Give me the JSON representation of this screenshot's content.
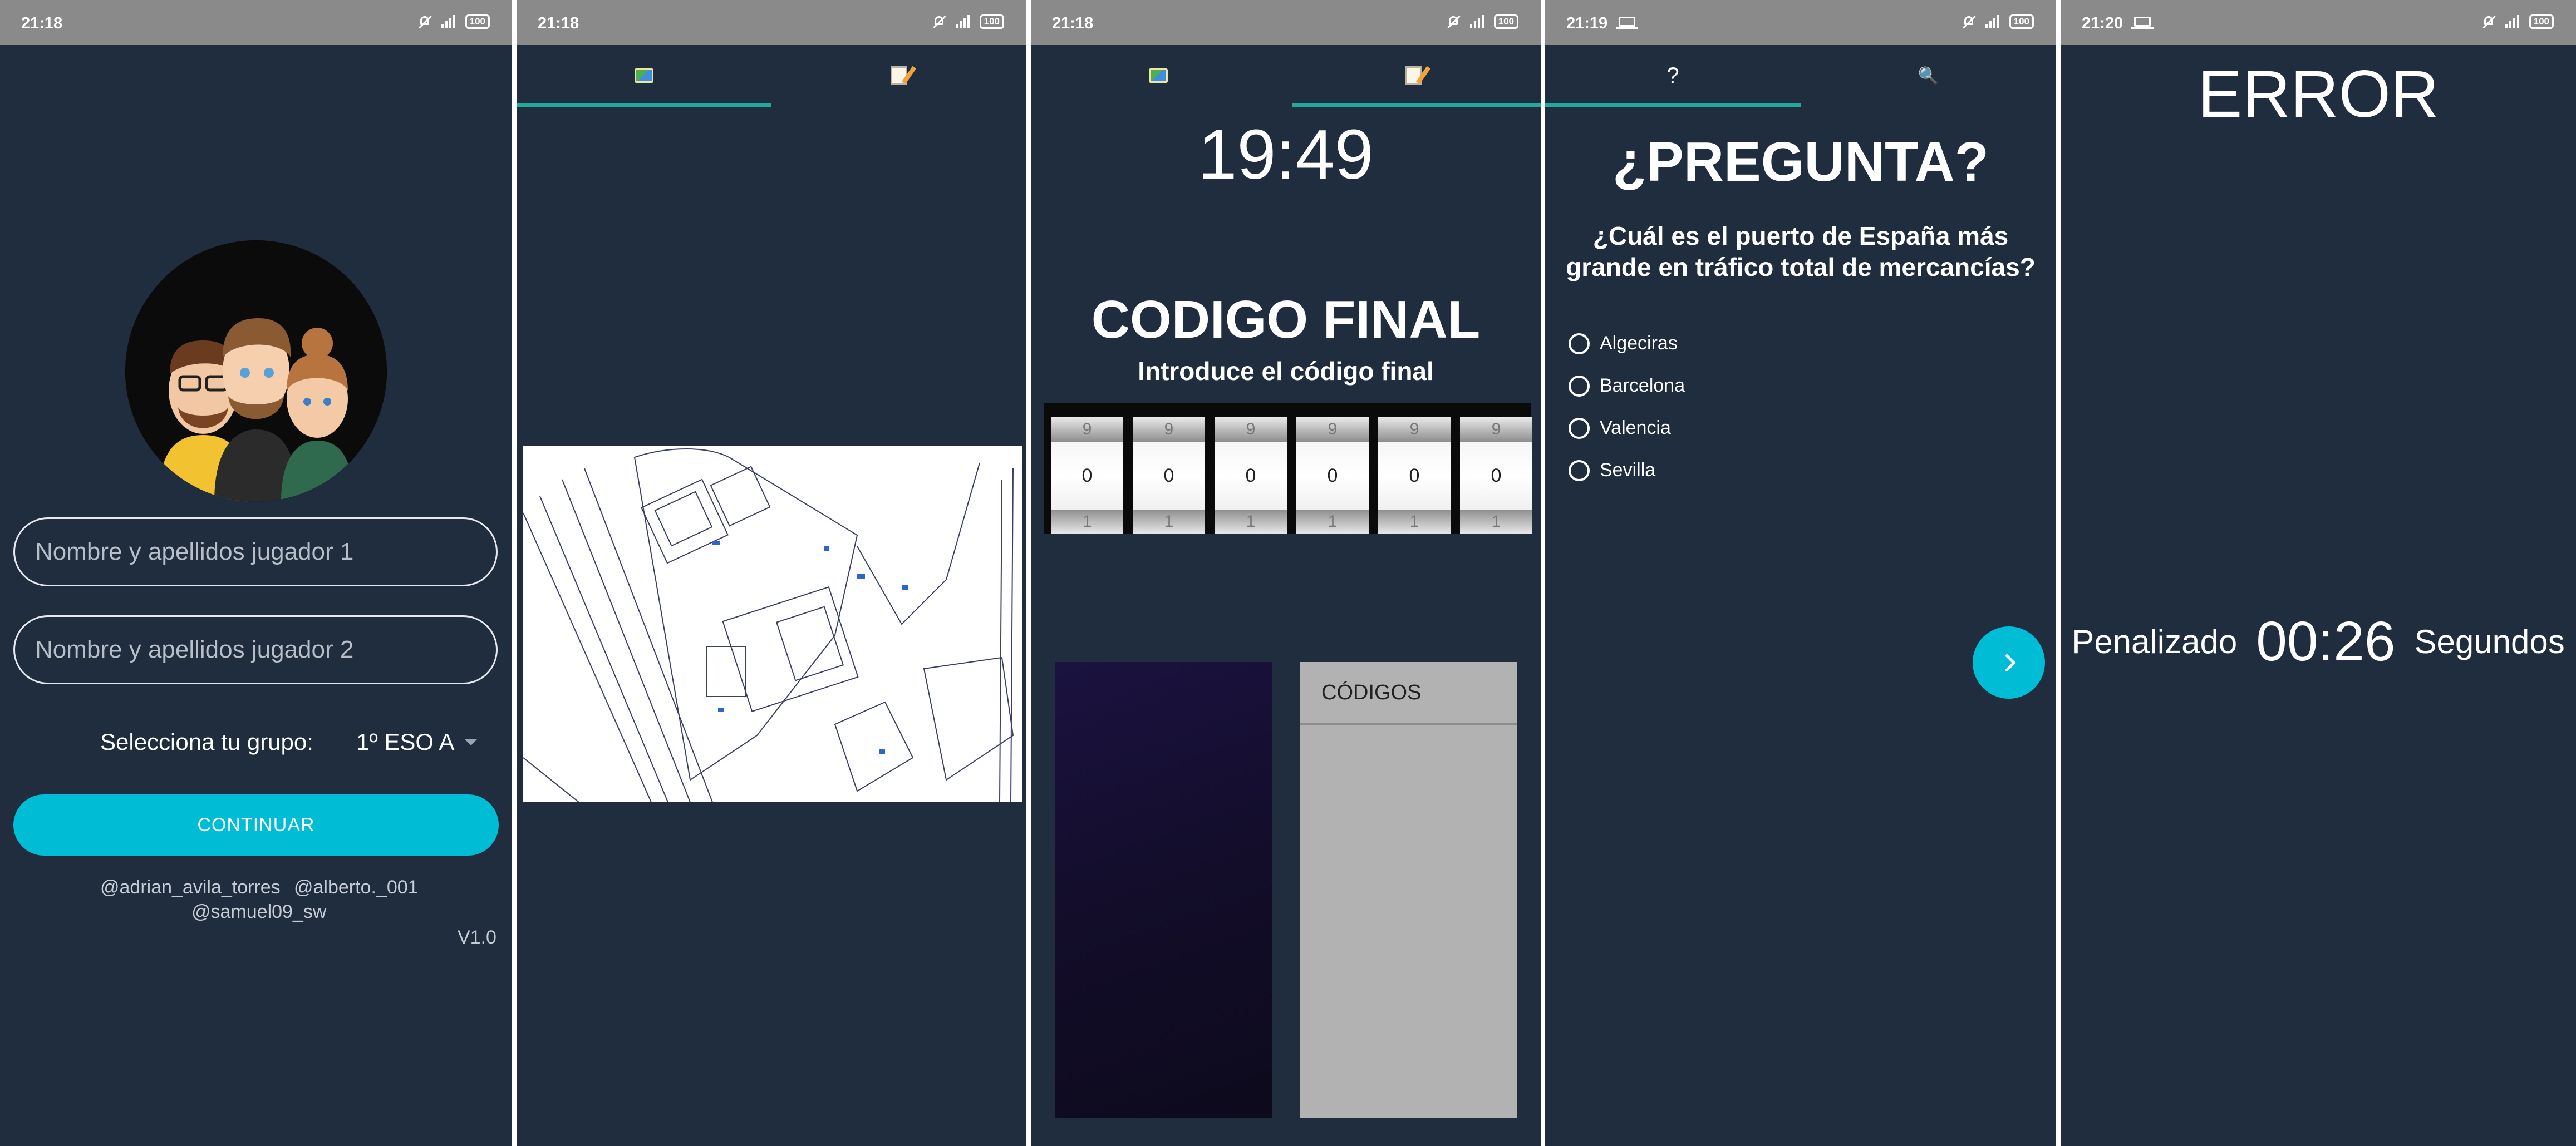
{
  "screen1": {
    "status_time": "21:18",
    "battery": "100",
    "player1_placeholder": "Nombre y apellidos jugador 1",
    "player2_placeholder": "Nombre y apellidos jugador 2",
    "group_label": "Selecciona tu grupo:",
    "group_value": "1º ESO A",
    "continue_label": "CONTINUAR",
    "credit1": "@adrian_avila_torres",
    "credit2": "@alberto._001",
    "credit3": "@samuel09_sw",
    "version": "V1.0"
  },
  "screen2": {
    "status_time": "21:18",
    "battery": "100",
    "tabs": [
      {
        "icon": "map-icon"
      },
      {
        "icon": "memo-icon"
      }
    ]
  },
  "screen3": {
    "status_time": "21:18",
    "battery": "100",
    "timer": "19:49",
    "title": "CODIGO FINAL",
    "subtitle": "Introduce el código final",
    "drums": [
      {
        "prev": "9",
        "value": "0",
        "next": "1"
      },
      {
        "prev": "9",
        "value": "0",
        "next": "1"
      },
      {
        "prev": "9",
        "value": "0",
        "next": "1"
      },
      {
        "prev": "9",
        "value": "0",
        "next": "1"
      },
      {
        "prev": "9",
        "value": "0",
        "next": "1"
      },
      {
        "prev": "9",
        "value": "0",
        "next": "1"
      }
    ],
    "codes_header": "CÓDIGOS"
  },
  "screen4": {
    "status_time": "21:19",
    "battery": "100",
    "tab1": "?",
    "tab2": "🔍",
    "title": "¿PREGUNTA?",
    "question": "¿Cuál es el puerto de España más grande en tráfico total de mercancías?",
    "options": [
      "Algeciras",
      "Barcelona",
      "Valencia",
      "Sevilla"
    ],
    "next_icon": "chevron-right-icon"
  },
  "screen5": {
    "status_time": "21:20",
    "battery": "100",
    "title": "ERROR",
    "penalty_label": "Penalizado",
    "penalty_time": "00:26",
    "penalty_unit": "Segundos"
  },
  "colors": {
    "background": "#1f2d3e",
    "accent": "#00bcd4",
    "tab_indicator": "#22a99a",
    "statusbar": "#8a8a8a"
  }
}
